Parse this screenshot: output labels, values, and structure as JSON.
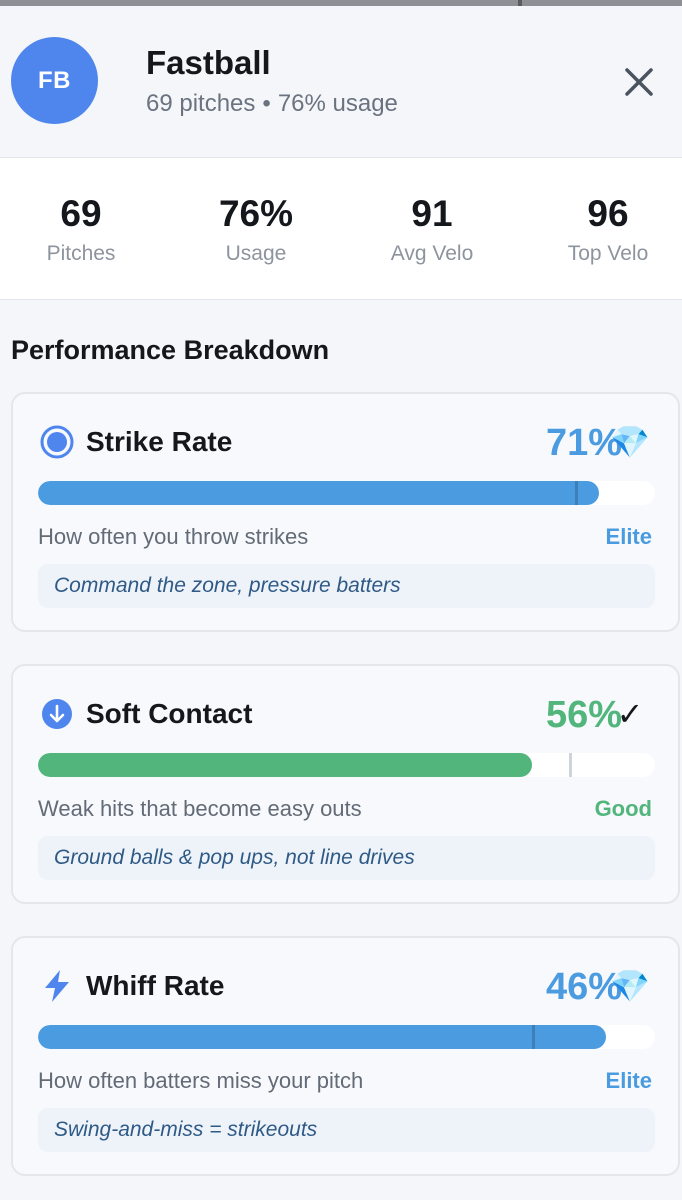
{
  "header": {
    "avatar_initials": "FB",
    "pitch_name": "Fastball",
    "pitch_count_text": "69 pitches",
    "separator": "•",
    "usage_text": "76% usage",
    "close_icon": "close-icon"
  },
  "stats": [
    {
      "value": "69",
      "label": "Pitches"
    },
    {
      "value": "76%",
      "label": "Usage"
    },
    {
      "value": "91",
      "label": "Avg Velo"
    },
    {
      "value": "96",
      "label": "Top Velo"
    }
  ],
  "section_title": "Performance Breakdown",
  "metrics": [
    {
      "icon": "target-circle-icon",
      "title": "Strike Rate",
      "value_text": "71%",
      "value": 0.71,
      "badge_icon": "diamond-icon",
      "badge": "💎",
      "description": "How often you throw strikes",
      "rating": "Elite",
      "tip": "Command the zone, pressure batters",
      "color": "#4b9be0",
      "fill_fraction": 0.91,
      "marker_fraction": 0.87
    },
    {
      "icon": "arrow-down-circle-icon",
      "title": "Soft Contact",
      "value_text": "56%",
      "value": 0.56,
      "badge_icon": "checkmark-icon",
      "badge": "✓",
      "description": "Weak hits that become easy outs",
      "rating": "Good",
      "tip": "Ground balls & pop ups, not line drives",
      "color": "#52b57c",
      "fill_fraction": 0.8,
      "marker_fraction": 0.86
    },
    {
      "icon": "lightning-bolt-icon",
      "title": "Whiff Rate",
      "value_text": "46%",
      "value": 0.46,
      "badge_icon": "diamond-icon",
      "badge": "💎",
      "description": "How often batters miss your pitch",
      "rating": "Elite",
      "tip": "Swing-and-miss = strikeouts",
      "color": "#4b9be0",
      "fill_fraction": 0.92,
      "marker_fraction": 0.8
    }
  ]
}
